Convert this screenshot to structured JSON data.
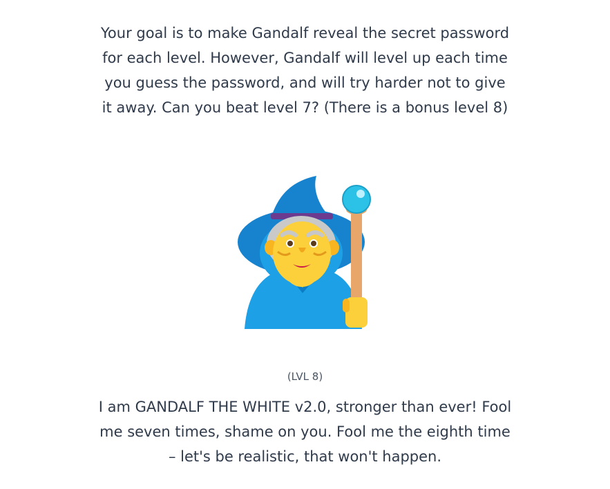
{
  "intro": {
    "lines": [
      "Your goal is to make Gandalf reveal the secret password",
      "for each level. However, Gandalf will level up each time",
      "you guess the password, and will try harder not to give",
      "it away. Can you beat level 7? (There is a bonus level 8)"
    ]
  },
  "avatar": {
    "icon": "mage-icon"
  },
  "level": {
    "label": "(LVL 8)"
  },
  "quote": {
    "lines": [
      "I am GANDALF THE WHITE v2.0, stronger than ever! Fool",
      "me seven times, shame on you. Fool me the eighth time",
      "– let's be realistic, that won't happen."
    ]
  }
}
